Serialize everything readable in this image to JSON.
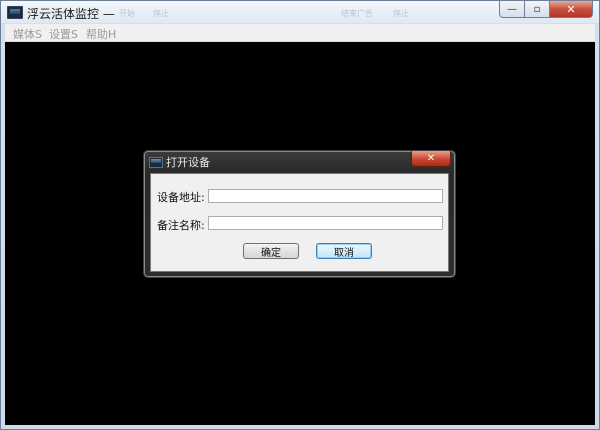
{
  "window": {
    "title": "浮云活体监控 —",
    "ghost_texts": [
      "开始",
      "停止",
      "结束广告",
      "停止"
    ],
    "controls": {
      "minimize": "—",
      "maximize": "▫",
      "close": "✕"
    }
  },
  "menubar": {
    "items": [
      {
        "label": "媒体S"
      },
      {
        "label": "设置S"
      },
      {
        "label": "帮助H"
      }
    ]
  },
  "dialog": {
    "title": "打开设备",
    "close_glyph": "✕",
    "fields": [
      {
        "label": "设备地址:",
        "value": "",
        "placeholder": ""
      },
      {
        "label": "备注名称:",
        "value": "",
        "placeholder": ""
      }
    ],
    "buttons": {
      "ok": "确定",
      "cancel": "取消"
    }
  },
  "colors": {
    "client_background": "#000000",
    "dialog_frame": "#2d2d2d",
    "dialog_body": "#f0f0f0",
    "close_button": "#c9472f"
  }
}
